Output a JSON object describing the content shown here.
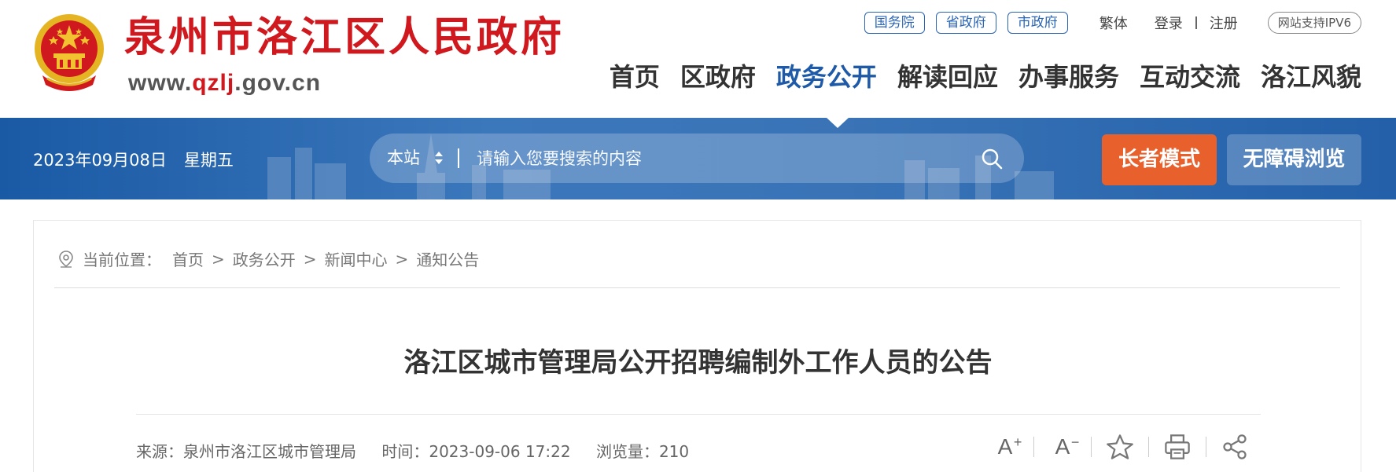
{
  "header": {
    "site_title": "泉州市洛江区人民政府",
    "site_url_prefix": "www.",
    "site_url_highlight": "qzlj",
    "site_url_suffix": ".gov.cn",
    "top_links": [
      "国务院",
      "省政府",
      "市政府"
    ],
    "traditional": "繁体",
    "login": "登录",
    "register": "注册",
    "ipv6": "网站支持IPV6",
    "nav": [
      {
        "label": "首页",
        "active": false
      },
      {
        "label": "区政府",
        "active": false
      },
      {
        "label": "政务公开",
        "active": true
      },
      {
        "label": "解读回应",
        "active": false
      },
      {
        "label": "办事服务",
        "active": false
      },
      {
        "label": "互动交流",
        "active": false
      },
      {
        "label": "洛江风貌",
        "active": false
      }
    ]
  },
  "banner": {
    "date": "2023年09月08日",
    "weekday": "星期五",
    "search_scope": "本站",
    "search_placeholder": "请输入您要搜索的内容",
    "elder_mode": "长者模式",
    "accessibility": "无障碍浏览"
  },
  "breadcrumb": {
    "label": "当前位置：",
    "items": [
      "首页",
      "政务公开",
      "新闻中心",
      "通知公告"
    ],
    "separator": ">"
  },
  "article": {
    "title": "洛江区城市管理局公开招聘编制外工作人员的公告",
    "source": "来源：泉州市洛江区城市管理局",
    "time": "时间：2023-09-06 17:22",
    "views": "浏览量：210"
  },
  "tools": {
    "font_larger": "A",
    "font_larger_sign": "+",
    "font_smaller": "A",
    "font_smaller_sign": "−",
    "icons": [
      "font-increase-icon",
      "font-decrease-icon",
      "favorite-star-icon",
      "print-icon",
      "share-icon"
    ]
  },
  "colors": {
    "brand_red": "#d0191f",
    "nav_active": "#1e5aa8",
    "banner_blue": "#2a64b0",
    "elder_orange": "#e8612c"
  }
}
